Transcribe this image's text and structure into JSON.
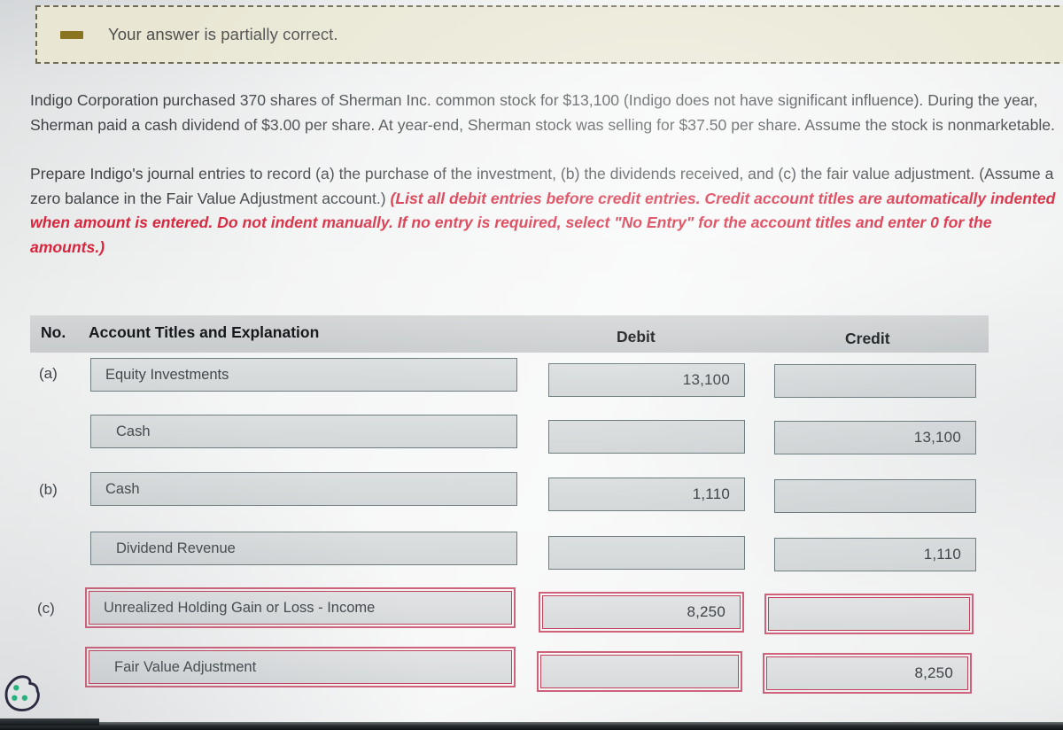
{
  "banner": {
    "icon": "minus-mark-icon",
    "text": "Your answer is partially correct."
  },
  "problem": {
    "paragraph1": "Indigo Corporation purchased 370 shares of Sherman Inc. common stock for $13,100 (Indigo does not have significant influence). During the year, Sherman paid a cash dividend of $3.00 per share. At year-end, Sherman stock was selling for $37.50 per share. Assume the stock is nonmarketable.",
    "paragraph2_plain": "Prepare Indigo's journal entries to record (a) the purchase of the investment, (b) the dividends received, and (c) the fair value adjustment. (Assume a zero balance in the Fair Value Adjustment account.) ",
    "paragraph2_emphasis": "(List all debit entries before credit entries. Credit account titles are automatically indented when amount is entered. Do not indent manually. If no entry is required, select \"No Entry\" for the account titles and enter 0 for the amounts.)"
  },
  "table": {
    "headers": {
      "no": "No.",
      "account": "Account Titles and Explanation",
      "debit": "Debit",
      "credit": "Credit"
    },
    "rows": [
      {
        "no": "(a)",
        "account": "Equity Investments",
        "indented": false,
        "debit": "13,100",
        "credit": "",
        "state": "normal"
      },
      {
        "no": "",
        "account": "Cash",
        "indented": true,
        "debit": "",
        "credit": "13,100",
        "state": "normal"
      },
      {
        "no": "(b)",
        "account": "Cash",
        "indented": false,
        "debit": "1,110",
        "credit": "",
        "state": "normal"
      },
      {
        "no": "",
        "account": "Dividend Revenue",
        "indented": true,
        "debit": "",
        "credit": "1,110",
        "state": "normal"
      },
      {
        "no": "(c)",
        "account": "Unrealized Holding Gain or Loss - Income",
        "indented": false,
        "debit": "8,250",
        "credit": "",
        "state": "error"
      },
      {
        "no": "",
        "account": "Fair Value Adjustment",
        "indented": true,
        "debit": "",
        "credit": "8,250",
        "state": "error"
      }
    ]
  },
  "widgets": {
    "cookie_icon": "cookie-consent-icon"
  },
  "colors": {
    "banner_bg": "#e9e7d4",
    "banner_border": "#6e6a57",
    "emphasis_red": "#d7263d",
    "error_border": "#c2415a",
    "field_border": "#6d7d80",
    "header_bg": "#d0d3d4",
    "page_bg": "#e6e8e8"
  }
}
